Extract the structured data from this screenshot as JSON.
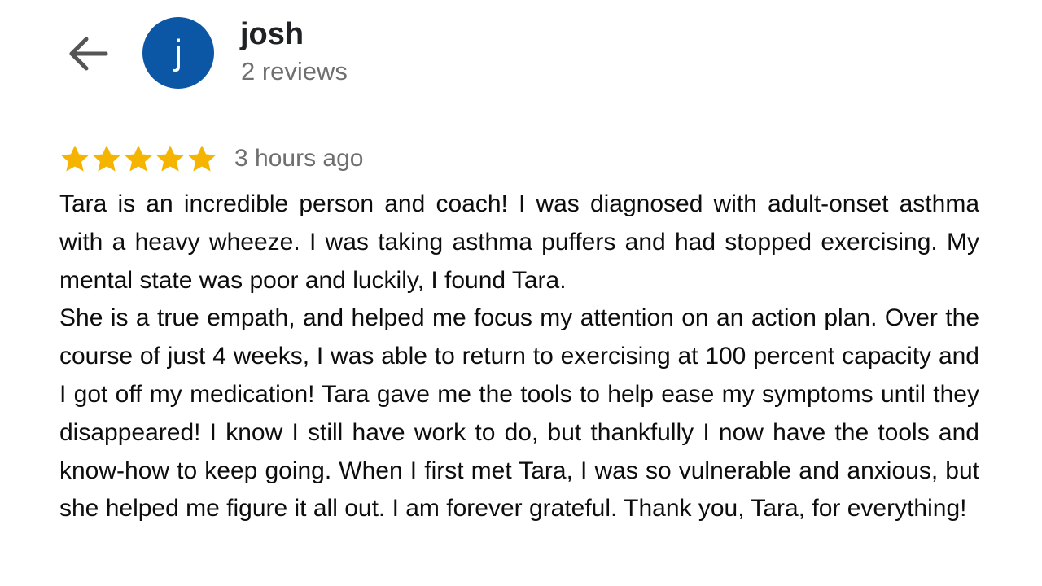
{
  "header": {
    "back_icon": "arrow-left-icon",
    "avatar": {
      "initial": "j",
      "color": "#0B57A6"
    },
    "user_name": "josh",
    "review_count": "2 reviews"
  },
  "review": {
    "rating": 5,
    "max_rating": 5,
    "star_icon": "star-icon",
    "star_color": "#F5B400",
    "timestamp": "3 hours ago",
    "paragraphs": [
      "Tara is an incredible person and coach! I was diagnosed with adult-onset asthma with a heavy wheeze. I was taking asthma puffers and had stopped exercising. My mental state was poor and luckily, I found Tara.",
      "She is a true empath, and helped me focus my attention on an action plan. Over the course of just 4 weeks, I was able to return to exercising at 100 percent capacity and I got off my medication! Tara gave me the tools to help ease my symptoms until they disappeared! I know I still have work to do, but thankfully I now have the tools and know-how to keep going. When I first met Tara, I was so vulnerable and anxious, but she helped me figure it all out. I am forever grateful. Thank you, Tara, for everything!"
    ]
  }
}
